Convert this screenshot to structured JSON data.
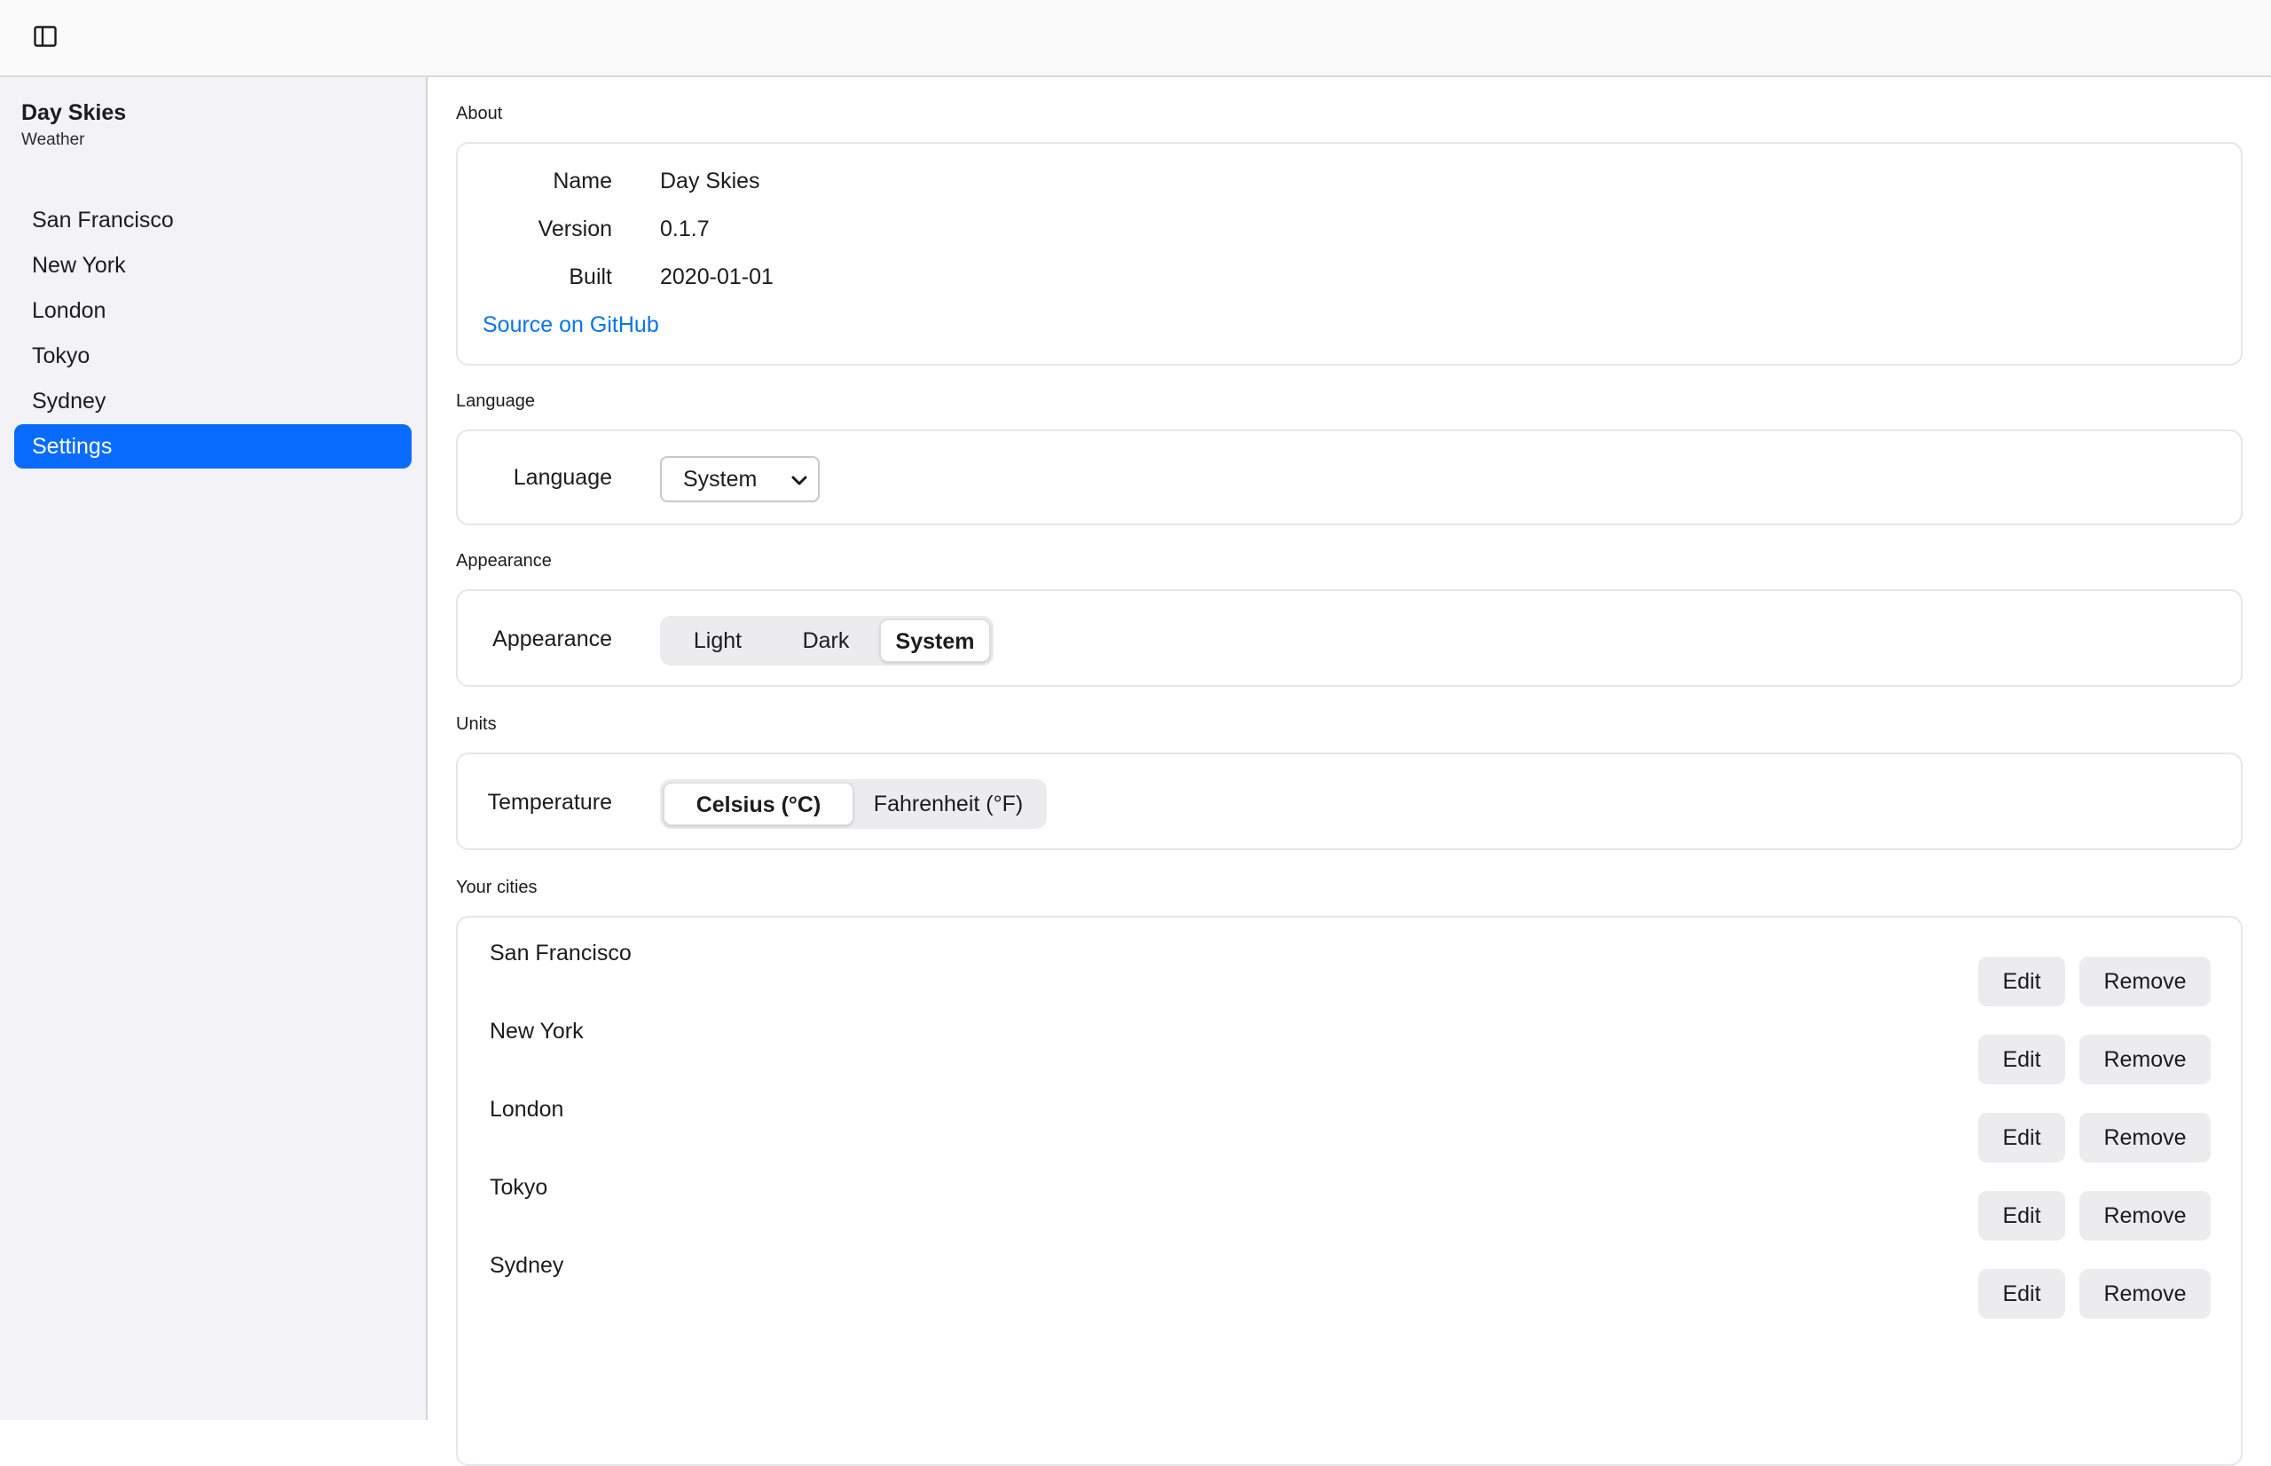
{
  "topbar": {
    "toggle_icon": "sidebar-icon"
  },
  "sidebar": {
    "app_name": "Day Skies",
    "app_subtitle": "Weather",
    "items": [
      {
        "label": "San Francisco"
      },
      {
        "label": "New York"
      },
      {
        "label": "London"
      },
      {
        "label": "Tokyo"
      },
      {
        "label": "Sydney"
      },
      {
        "label": "Settings",
        "active": true
      }
    ]
  },
  "about": {
    "section_label": "About",
    "name_key": "Name",
    "name_value": "Day Skies",
    "version_key": "Version",
    "version_value": "0.1.7",
    "built_key": "Built",
    "built_value": "2020-01-01",
    "source_link": "Source on GitHub"
  },
  "language": {
    "section_label": "Language",
    "row_label": "Language",
    "selected": "System"
  },
  "appearance": {
    "section_label": "Appearance",
    "row_label": "Appearance",
    "options": [
      "Light",
      "Dark",
      "System"
    ],
    "selected": "System"
  },
  "units": {
    "section_label": "Units",
    "row_label": "Temperature",
    "options": [
      "Celsius (°C)",
      "Fahrenheit (°F)"
    ],
    "selected": "Celsius (°C)"
  },
  "cities": {
    "section_label": "Your cities",
    "edit_label": "Edit",
    "remove_label": "Remove",
    "items": [
      "San Francisco",
      "New York",
      "London",
      "Tokyo",
      "Sydney"
    ]
  },
  "colors": {
    "accent": "#0a6cff",
    "link": "#0a74ec",
    "sidebar_bg": "#f2f2f7"
  }
}
